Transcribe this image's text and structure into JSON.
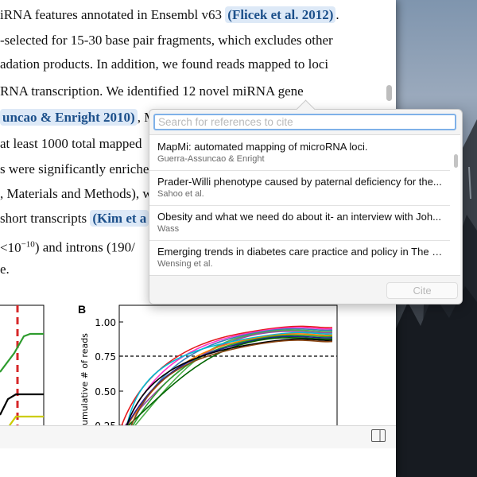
{
  "document": {
    "lines": [
      {
        "pre": "iRNA features annotated in Ensembl v63 ",
        "cite": "(Flicek et al. 2012)",
        "post": "."
      },
      {
        "pre": "-selected for 15-30 base pair fragments, which excludes other",
        "cite": "",
        "post": ""
      },
      {
        "pre": "adation products. In addition, we found reads mapped to loci",
        "cite": "",
        "post": ""
      },
      {
        "pre": "RNA transcription. We identified 12 novel miRNA gene",
        "cite": "",
        "post": ""
      },
      {
        "pre": "",
        "cite": "uncao & Enright 2010)",
        "post": ", M"
      },
      {
        "pre": "at least 1000 total mapped",
        "cite": "",
        "post": ""
      },
      {
        "pre": "s were significantly enriche",
        "cite": "",
        "post": ""
      },
      {
        "pre": ", Materials and Methods), w",
        "cite": "",
        "post": ""
      },
      {
        "pre": "short transcripts ",
        "cite": "(Kim et a",
        "post": ""
      },
      {
        "pre": "",
        "cite": "",
        "post": ") and introns (190/"
      },
      {
        "pre": "e.",
        "cite": "",
        "post": ""
      }
    ],
    "exponent_line": {
      "base": "<10",
      "exponent": "−10"
    }
  },
  "figure": {
    "panel_b_label": "B",
    "ylabel": "umulative # of reads",
    "y_ticks": [
      "1.00",
      "0.75",
      "0.50",
      "0.25"
    ]
  },
  "chart_data": [
    {
      "type": "line",
      "title": "B",
      "ylabel": "umulative # of reads",
      "ylim": [
        0.25,
        1.05
      ],
      "reference_line": {
        "y": 0.75,
        "style": "dashed",
        "color": "#000000"
      },
      "series_colors": [
        "#e41a1c",
        "#ff33cc",
        "#377eb8",
        "#4daf4a",
        "#984ea3",
        "#00bcd4",
        "#ff7f00",
        "#2ca02c",
        "#1f1f8f",
        "#006400",
        "#000000",
        "#8b4513"
      ]
    },
    {
      "type": "line",
      "title": "",
      "series": [
        {
          "color": "#2e9c2e"
        },
        {
          "color": "#000000"
        },
        {
          "color": "#cccc00"
        }
      ],
      "reference_line": {
        "orientation": "vertical",
        "style": "dashed",
        "color": "#d62728"
      }
    }
  ],
  "popover": {
    "search_placeholder": "Search for references to cite",
    "results": [
      {
        "title": "MapMi: automated mapping of microRNA loci.",
        "authors": "Guerra-Assuncao & Enright"
      },
      {
        "title": "Prader-Willi phenotype caused by paternal deficiency for the...",
        "authors": "Sahoo et al."
      },
      {
        "title": "Obesity and what we need do about it- an interview with Joh...",
        "authors": "Wass"
      },
      {
        "title": "Emerging trends in diabetes care practice and policy in The N...",
        "authors": "Wensing et al."
      }
    ],
    "cite_label": "Cite"
  },
  "icons": {
    "panel_toggle": "sidebar-toggle-icon"
  }
}
